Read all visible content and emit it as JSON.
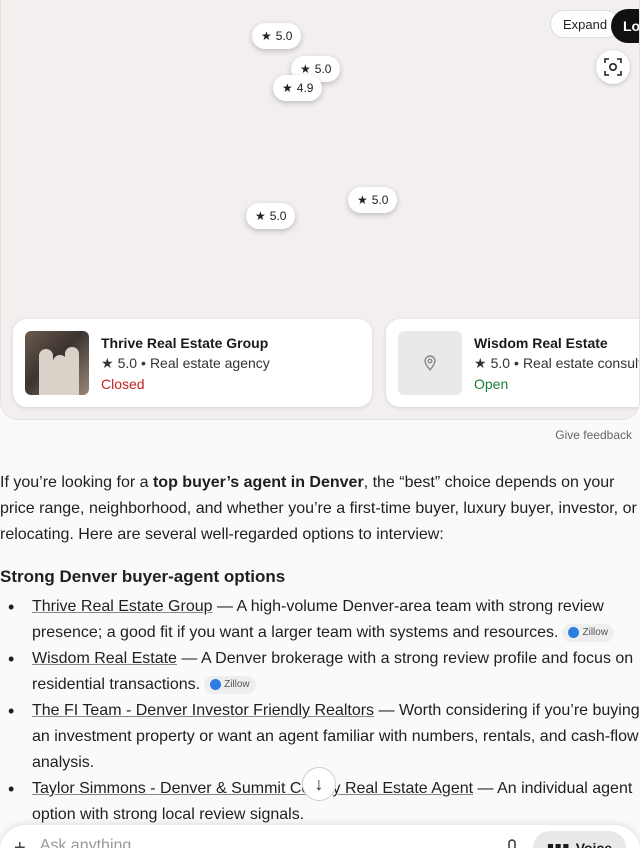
{
  "map": {
    "pins": [
      {
        "rating": "5.0"
      },
      {
        "rating": "5.0"
      },
      {
        "rating": "4.9"
      },
      {
        "rating": "5.0"
      },
      {
        "rating": "5.0"
      }
    ],
    "expand_label": "Expand",
    "login_label": "Log in"
  },
  "places": [
    {
      "name": "Thrive Real Estate Group",
      "rating": "5.0",
      "category": "Real estate agency",
      "status": "Closed"
    },
    {
      "name": "Wisdom Real Estate",
      "rating": "5.0",
      "category": "Real estate consultant",
      "status": "Open"
    }
  ],
  "feedback_label": "Give feedback",
  "answer": {
    "intro_pre": "If you’re looking for a ",
    "intro_bold": "top buyer’s agent in Denver",
    "intro_post": ", the “best” choice depends on your price range, neighborhood, and whether you’re a first-time buyer, luxury buyer, investor, or relocating. Here are several well-regarded options to interview:",
    "heading": "Strong Denver buyer-agent options",
    "items": [
      {
        "link": "Thrive Real Estate Group",
        "text": " — A high-volume Denver-area team with strong review presence; a good fit if you want a larger team with systems and resources.",
        "source": "Zillow"
      },
      {
        "link": "Wisdom Real Estate",
        "text": " — A Denver brokerage with a strong review profile and focus on residential transactions.",
        "source": "Zillow"
      },
      {
        "link": "The FI Team - Denver Investor Friendly Realtors",
        "text": " — Worth considering if you’re buying an investment property or want an agent familiar with numbers, rentals, and cash-flow analysis.",
        "source": ""
      },
      {
        "link": "Taylor Simmons - Denver & Summit County Real Estate Agent",
        "text": " — An individual agent option with strong local review signals.",
        "source": ""
      }
    ]
  },
  "composer": {
    "placeholder": "Ask anything",
    "voice_label": "Voice"
  }
}
